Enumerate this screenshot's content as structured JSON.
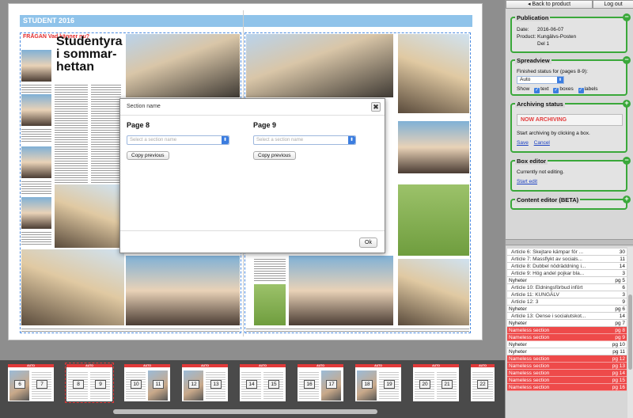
{
  "spread": {
    "header_left": "STUDENT 2016",
    "kicker": "FRÅGAN Vad känner nu?",
    "headline_line1": "Studentyra",
    "headline_line2": "i sommar-",
    "headline_line3": "hettan"
  },
  "modal": {
    "title": "Section name",
    "close_glyph": "✖",
    "left": {
      "page_label": "Page 8",
      "placeholder": "Select a section name",
      "copy_label": "Copy previous"
    },
    "right": {
      "page_label": "Page 9",
      "placeholder": "Select a section name",
      "copy_label": "Copy previous"
    },
    "ok_label": "Ok"
  },
  "thumbnails": [
    {
      "pages": [
        "6",
        "7"
      ],
      "header": "AUTO"
    },
    {
      "pages": [
        "8",
        "9"
      ],
      "header": "AUTO",
      "selected": true
    },
    {
      "pages": [
        "10",
        "11"
      ],
      "header": "AUTO"
    },
    {
      "pages": [
        "12",
        "13"
      ],
      "header": "AUTO"
    },
    {
      "pages": [
        "14",
        "15"
      ],
      "header": "AUTO"
    },
    {
      "pages": [
        "16",
        "17"
      ],
      "header": "AUTO"
    },
    {
      "pages": [
        "18",
        "19"
      ],
      "header": "AUTO"
    },
    {
      "pages": [
        "20",
        "21"
      ],
      "header": "AUTO"
    },
    {
      "pages": [
        "22"
      ],
      "header": "AUTO"
    }
  ],
  "sidebar": {
    "back_label": "◂ Back to product",
    "logout_label": "Log out",
    "publication": {
      "title": "Publication",
      "date_key": "Date:",
      "date_val": "2016-06-07",
      "product_key": "Product:",
      "product_val": "Kungälvs-Posten",
      "part_val": "Del 1"
    },
    "spreadview": {
      "title": "Spreadview",
      "status_label": "Finished status for (pages 8-9):",
      "status_value": "Auto",
      "show_label": "Show",
      "opt_text": "text",
      "opt_boxes": "boxes",
      "opt_labels": "labels"
    },
    "archiving": {
      "title": "Archiving status",
      "status": "NOW ARCHIVING",
      "hint": "Start archiving by clicking a box.",
      "save": "Save",
      "cancel": "Cancel"
    },
    "box_editor": {
      "title": "Box editor",
      "status": "Currently not editing.",
      "start": "Start edit"
    },
    "content_editor": {
      "title": "Content editor (BETA)"
    },
    "colors": {
      "panel_border": "#3aa83a",
      "nameless": "#ee4a4a",
      "link": "#1a3fc2"
    }
  },
  "list": [
    {
      "name": "Article 6: Skejtare kämpar för ...",
      "val": "30",
      "kind": "article"
    },
    {
      "name": "Article 7: Massflykt av socials...",
      "val": "11",
      "kind": "article"
    },
    {
      "name": "Article 8: Dubbel nödräddning i...",
      "val": "14",
      "kind": "article"
    },
    {
      "name": "Article 9: Hög andel pojkar bla...",
      "val": "3",
      "kind": "article"
    },
    {
      "name": "Nyheter",
      "val": "pg 5",
      "kind": "section"
    },
    {
      "name": "Article 10: Eldningsförbud infört",
      "val": "6",
      "kind": "article"
    },
    {
      "name": "Article 11: KUNGÄLV",
      "val": "3",
      "kind": "article"
    },
    {
      "name": "Article 12: 3",
      "val": "9",
      "kind": "article"
    },
    {
      "name": "Nyheter",
      "val": "pg 6",
      "kind": "section"
    },
    {
      "name": "Article 13: Oense i socialutskot...",
      "val": "14",
      "kind": "article"
    },
    {
      "name": "Nyheter",
      "val": "pg 7",
      "kind": "section"
    },
    {
      "name": "Nameless section",
      "val": "pg 8",
      "kind": "nameless"
    },
    {
      "name": "Nameless section",
      "val": "pg 9",
      "kind": "nameless"
    },
    {
      "name": "Nyheter",
      "val": "pg 10",
      "kind": "section"
    },
    {
      "name": "Nyheter",
      "val": "pg 11",
      "kind": "section"
    },
    {
      "name": "Nameless section",
      "val": "pg 12",
      "kind": "nameless"
    },
    {
      "name": "Nameless section",
      "val": "pg 13",
      "kind": "nameless"
    },
    {
      "name": "Nameless section",
      "val": "pg 14",
      "kind": "nameless"
    },
    {
      "name": "Nameless section",
      "val": "pg 15",
      "kind": "nameless"
    },
    {
      "name": "Nameless section",
      "val": "pg 16",
      "kind": "nameless"
    }
  ]
}
